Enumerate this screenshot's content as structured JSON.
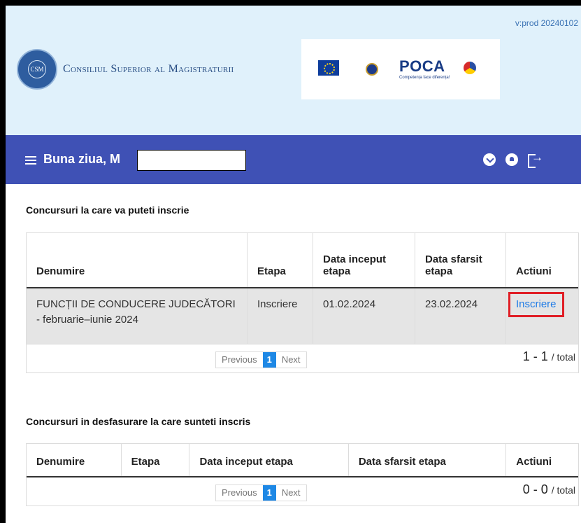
{
  "header": {
    "version": "v:prod 20240102",
    "institution": "Consiliul Superior al Magistraturii",
    "csm_logo_text": "CSM",
    "sponsor_poca": "POCA",
    "sponsor_poca_sub": "Competența face diferența!"
  },
  "navbar": {
    "greeting": "Buna ziua, M",
    "icons": [
      "download-icon",
      "bell-icon",
      "logout-icon"
    ]
  },
  "available": {
    "title": "Concursuri la care va puteti inscrie",
    "columns": [
      "Denumire",
      "Etapa",
      "Data inceput etapa",
      "Data sfarsit etapa",
      "Actiuni"
    ],
    "rows": [
      {
        "name": "FUNCȚII DE CONDUCERE JUDECĂTORI - februarie–iunie 2024",
        "stage": "Inscriere",
        "start": "01.02.2024",
        "end": "23.02.2024",
        "action": "Inscriere"
      }
    ],
    "pager": {
      "prev": "Previous",
      "page": "1",
      "next": "Next"
    },
    "total": "1 - 1",
    "total_suffix": "/ total"
  },
  "enrolled": {
    "title": "Concursuri in desfasurare la care sunteti inscris",
    "columns": [
      "Denumire",
      "Etapa",
      "Data inceput etapa",
      "Data sfarsit etapa",
      "Actiuni"
    ],
    "pager": {
      "prev": "Previous",
      "page": "1",
      "next": "Next"
    },
    "total": "0 - 0",
    "total_suffix": "/ total"
  },
  "colors": {
    "navbar": "#3f51b5",
    "header_bg": "#e0f1fb",
    "link": "#1e7be6",
    "highlight": "#e01f26",
    "pager_active": "#1e88e5"
  }
}
